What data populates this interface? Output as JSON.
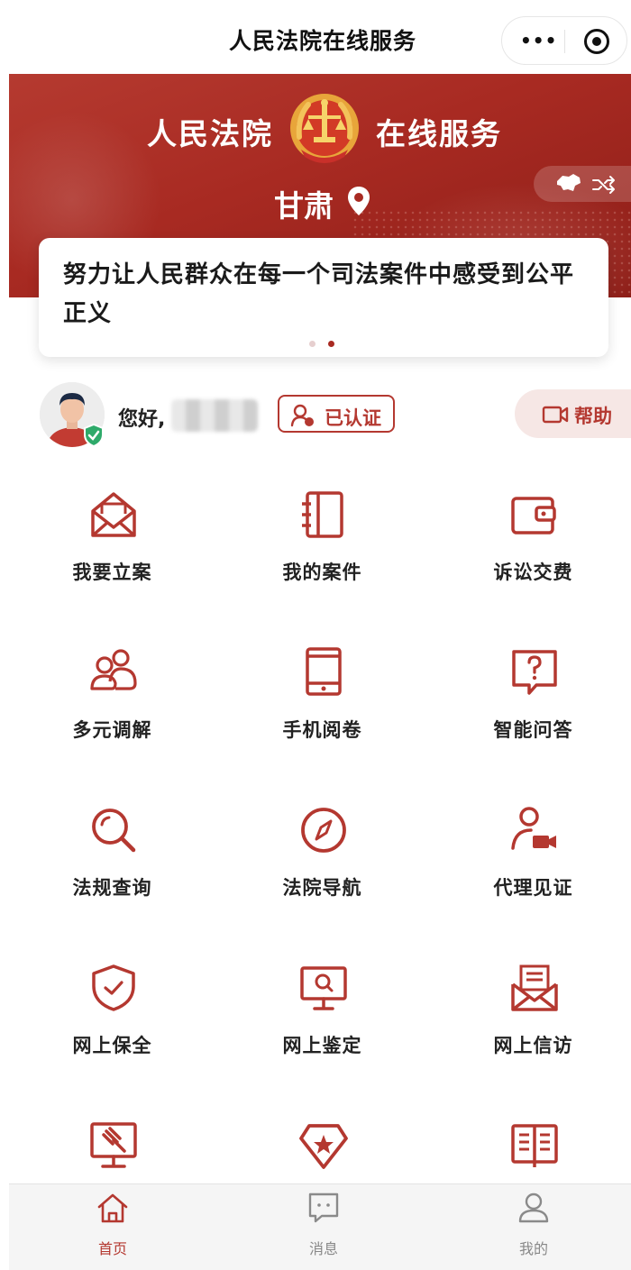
{
  "nav": {
    "title": "人民法院在线服务"
  },
  "banner": {
    "left_title": "人民法院",
    "right_title": "在线服务",
    "region": "甘肃"
  },
  "slogan": {
    "text": "努力让人民群众在每一个司法案件中感受到公平正义",
    "pages": 2,
    "active_page": 2
  },
  "user": {
    "greeting": "您好,",
    "verified_label": "已认证",
    "help_label": "帮助"
  },
  "services": [
    {
      "label": "我要立案",
      "icon": "envelope-icon"
    },
    {
      "label": "我的案件",
      "icon": "notebook-icon"
    },
    {
      "label": "诉讼交费",
      "icon": "wallet-icon"
    },
    {
      "label": "多元调解",
      "icon": "people-icon"
    },
    {
      "label": "手机阅卷",
      "icon": "phone-icon"
    },
    {
      "label": "智能问答",
      "icon": "question-icon"
    },
    {
      "label": "法规查询",
      "icon": "magnifier-icon"
    },
    {
      "label": "法院导航",
      "icon": "compass-icon"
    },
    {
      "label": "代理见证",
      "icon": "video-person-icon"
    },
    {
      "label": "网上保全",
      "icon": "shield-check-icon"
    },
    {
      "label": "网上鉴定",
      "icon": "monitor-search-icon"
    },
    {
      "label": "网上信访",
      "icon": "mail-letter-icon"
    },
    {
      "label": "",
      "icon": "gavel-monitor-icon"
    },
    {
      "label": "",
      "icon": "star-badge-icon"
    },
    {
      "label": "",
      "icon": "open-book-icon"
    }
  ],
  "tabs": [
    {
      "label": "首页",
      "icon": "home-icon",
      "active": true
    },
    {
      "label": "消息",
      "icon": "message-icon",
      "active": false
    },
    {
      "label": "我的",
      "icon": "person-icon",
      "active": false
    }
  ],
  "colors": {
    "primary": "#b43830",
    "banner": "#a82a22",
    "tab_inactive": "#888888"
  }
}
